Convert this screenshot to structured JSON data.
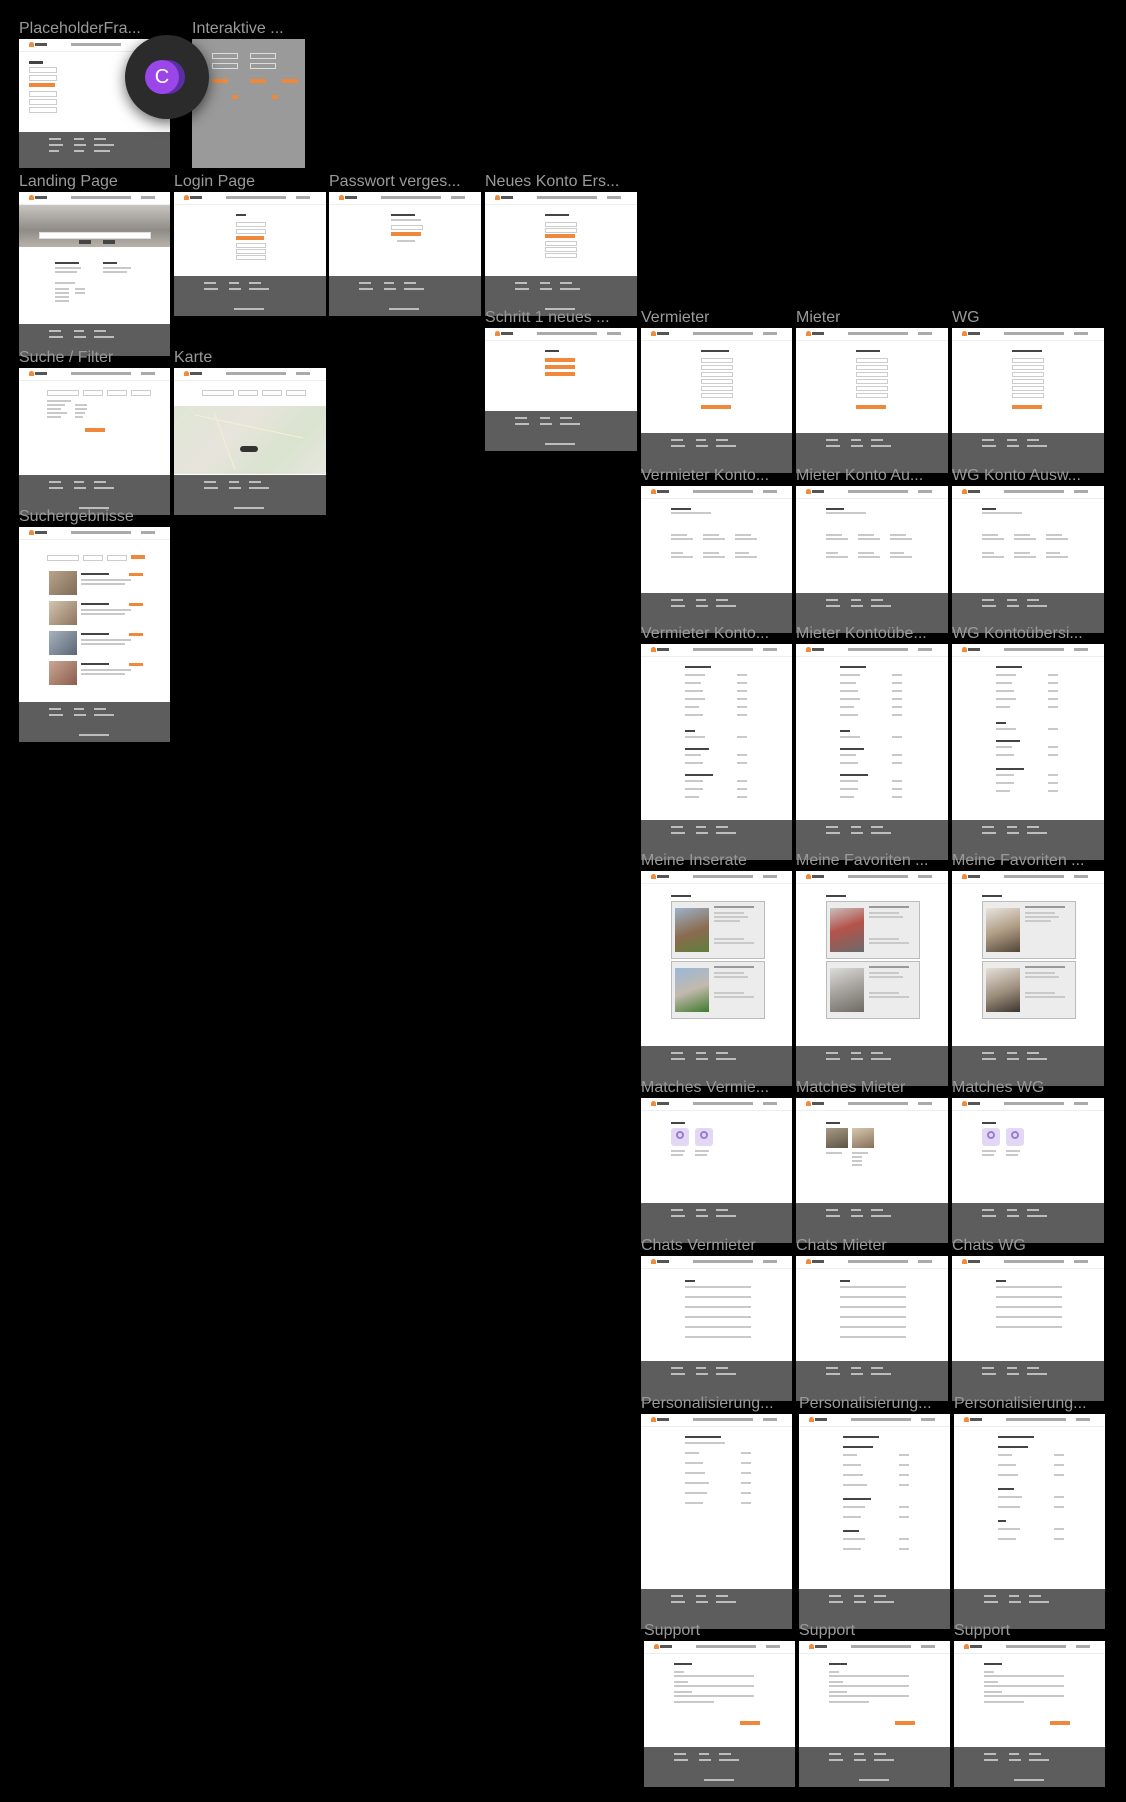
{
  "app": {
    "accent": "#f0883c",
    "background": "#000000",
    "label_color": "#9a9a9a"
  },
  "presence": {
    "initial": "C",
    "color": "#9a46e9"
  },
  "frames": {
    "placeholder": "PlaceholderFra...",
    "interaktive": "Interaktive ...",
    "landing": "Landing Page",
    "login": "Login Page",
    "passwort": "Passwort verges...",
    "neues_konto": "Neues Konto Ers...",
    "schritt1": "Schritt 1 neues ...",
    "vermieter": "Vermieter",
    "mieter": "Mieter",
    "wg": "WG",
    "suche": "Suche / Filter",
    "karte": "Karte",
    "vermieter_konto_aus": "Vermieter Konto...",
    "mieter_konto_aus": "Mieter Konto Au...",
    "wg_konto_aus": "WG Konto Ausw...",
    "suchergebnisse": "Suchergebnisse",
    "vermieter_konto_ueb": "Vermieter Konto...",
    "mieter_konto_ueb": "Mieter Kontoübe...",
    "wg_konto_ueb": "WG Kontoübersi...",
    "meine_inserate": "Meine Inserate",
    "meine_favoriten_1": "Meine Favoriten ...",
    "meine_favoriten_2": "Meine Favoriten ...",
    "matches_vermieter": "Matches Vermie...",
    "matches_mieter": "Matches Mieter",
    "matches_wg": "Matches WG",
    "chats_vermieter": "Chats Vermieter",
    "chats_mieter": "Chats Mieter",
    "chats_wg": "Chats WG",
    "personalisierung_1": "Personalisierung...",
    "personalisierung_2": "Personalisierung...",
    "personalisierung_3": "Personalisierung...",
    "support_1": "Support",
    "support_2": "Support",
    "support_3": "Support"
  }
}
